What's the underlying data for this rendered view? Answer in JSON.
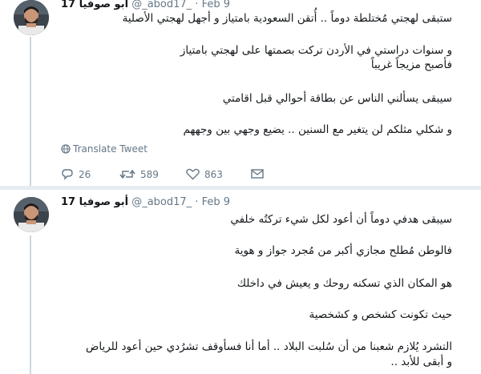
{
  "tweet1": {
    "name": "أبو صوفيا 17",
    "handle": "@_abod17_",
    "dot": "·",
    "date": "Feb 9",
    "lines": [
      "ستبقى لهجتي مُختلطة دوماً .. أُتقن السعودية بامتياز و أجهل لهجتي الأصلية",
      "و سنوات دراستي في الأردن تركت بصمتها على لهجتي بامتياز",
      "فأصبح مزيجاً غريباً",
      "سيبقى يسألني الناس عن بطاقة أحوالي قبل اقامتي",
      "و شكلي مثلكم لن يتغير مع السنين .. يضيع وجهي بين وجههم"
    ],
    "translate_label": "Translate Tweet",
    "replies": "26",
    "retweets": "589",
    "likes": "863"
  },
  "tweet2": {
    "name": "أبو صوفيا 17",
    "handle": "@_abod17_",
    "dot": "·",
    "date": "Feb 9",
    "lines": [
      "سيبقى هدفي دوماً أن أعود لكل شيء تركتُه خلفي",
      "فالوطن مُطلح مجازي أكبر من مُجرد جواز و هوية",
      "هو المكان الذي تسكنه روحك و يعيش في داخلك",
      "حيث تكونت كشخص و كشخصية",
      "التشرد يُلازم شعبنا من أن سُلبت البلاد .. أما أنا فسأوقف تشرُدي حين أعود للرياض",
      "و أبقى للأبد .."
    ]
  }
}
